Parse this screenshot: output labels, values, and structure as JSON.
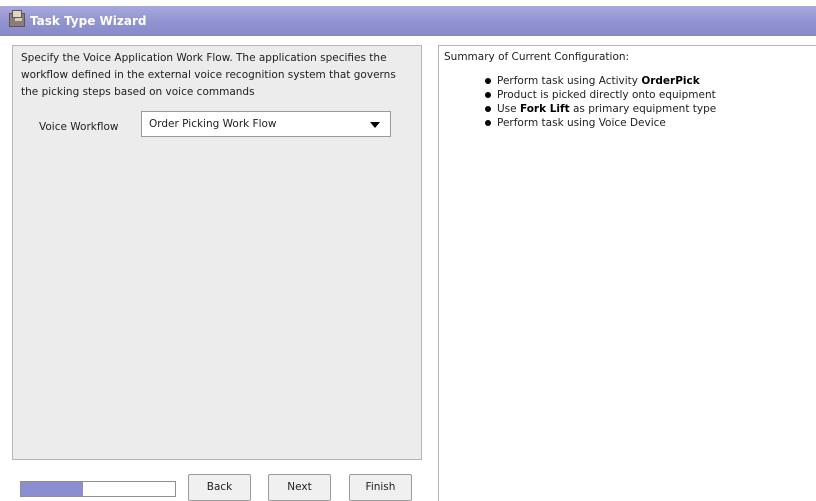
{
  "window": {
    "title": "Task Type Wizard",
    "icon": "wizard-icon"
  },
  "left_panel": {
    "instructions": "Specify the Voice Application Work Flow. The application specifies the workflow defined in the external voice recognition system that governs the picking steps based on voice commands",
    "voice_workflow": {
      "label": "Voice Workflow",
      "value": "Order Picking Work Flow"
    }
  },
  "summary": {
    "title": "Summary of Current Configuration:",
    "items": [
      {
        "prefix": "Perform task using Activity ",
        "bold": "OrderPick",
        "suffix": ""
      },
      {
        "prefix": "Product is picked directly onto equipment",
        "bold": "",
        "suffix": ""
      },
      {
        "prefix": "Use ",
        "bold": "Fork Lift",
        "suffix": " as primary equipment type"
      },
      {
        "prefix": "Perform task using Voice Device",
        "bold": "",
        "suffix": ""
      }
    ]
  },
  "footer": {
    "progress_fraction": 0.4,
    "back_label": "Back",
    "next_label": "Next",
    "finish_label": "Finish"
  },
  "colors": {
    "titlebar": "#9496d3",
    "progress": "#8b8fd2"
  }
}
